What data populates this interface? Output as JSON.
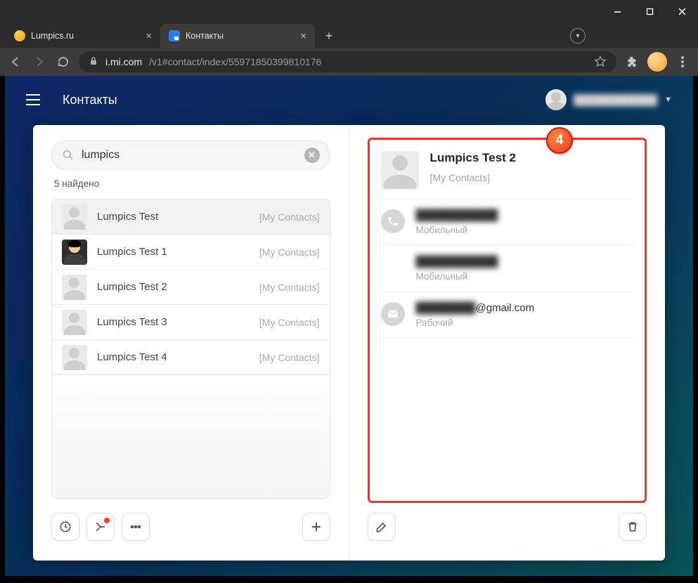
{
  "window": {
    "minimize": "–",
    "maximize": "□",
    "close": "×"
  },
  "tabs": [
    {
      "title": "Lumpics.ru",
      "active": false
    },
    {
      "title": "Контакты",
      "active": true
    }
  ],
  "url": {
    "host": "i.mi.com",
    "path": "/v1#contact/index/55971850399810176"
  },
  "app": {
    "title": "Контакты",
    "user": "████████████"
  },
  "search": {
    "value": "lumpics",
    "found_label": "5 найдено"
  },
  "contacts": [
    {
      "name": "Lumpics Test",
      "group": "[My Contacts]",
      "avatar": "silhouette",
      "selected": true
    },
    {
      "name": "Lumpics Test 1",
      "group": "[My Contacts]",
      "avatar": "dark",
      "selected": false
    },
    {
      "name": "Lumpics Test 2",
      "group": "[My Contacts]",
      "avatar": "silhouette",
      "selected": false
    },
    {
      "name": "Lumpics Test 3",
      "group": "[My Contacts]",
      "avatar": "silhouette",
      "selected": false
    },
    {
      "name": "Lumpics Test 4",
      "group": "[My Contacts]",
      "avatar": "silhouette",
      "selected": false
    }
  ],
  "detail": {
    "name": "Lumpics Test 2",
    "group": "[My Contacts]",
    "phone1": {
      "value": "███████████",
      "label": "Мобильный"
    },
    "phone2": {
      "value": "███████████",
      "label": "Мобильный"
    },
    "email": {
      "prefix": "████████",
      "suffix": "@gmail.com",
      "label": "Рабочий"
    }
  },
  "callout_number": "4"
}
